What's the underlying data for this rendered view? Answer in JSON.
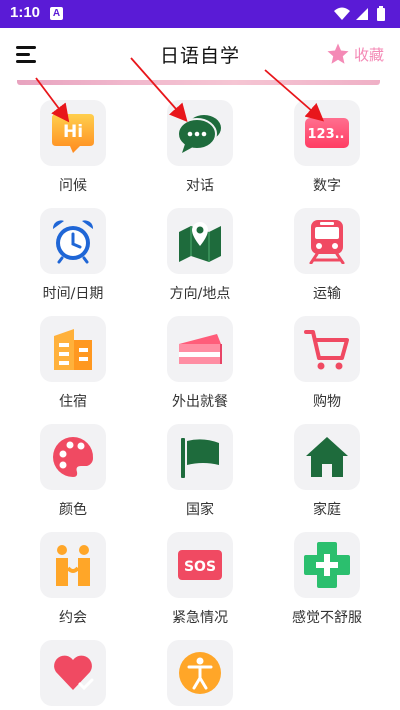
{
  "status_bar": {
    "time": "1:10",
    "notification_letter": "A",
    "icons": [
      "wifi-icon",
      "cellular-signal-icon",
      "battery-icon"
    ]
  },
  "app_bar": {
    "title": "日语自学",
    "favorites_label": "收藏",
    "icons": [
      "menu-icon",
      "star-icon"
    ]
  },
  "colors": {
    "status_bar": "#5a1bd6",
    "accent_pink": "#f48ab6",
    "tile_background": "#f2f2f4",
    "annotation_arrow": "#e8161b"
  },
  "categories": [
    {
      "label": "问候",
      "icon": "greeting-hi-icon"
    },
    {
      "label": "对话",
      "icon": "chat-bubble-icon"
    },
    {
      "label": "数字",
      "icon": "numbers-123-icon"
    },
    {
      "label": "时间/日期",
      "icon": "alarm-clock-icon"
    },
    {
      "label": "方向/地点",
      "icon": "map-pin-icon"
    },
    {
      "label": "运输",
      "icon": "train-icon"
    },
    {
      "label": "住宿",
      "icon": "building-icon"
    },
    {
      "label": "外出就餐",
      "icon": "cake-icon"
    },
    {
      "label": "购物",
      "icon": "shopping-cart-icon"
    },
    {
      "label": "颜色",
      "icon": "palette-icon"
    },
    {
      "label": "国家",
      "icon": "flag-icon"
    },
    {
      "label": "家庭",
      "icon": "house-icon"
    },
    {
      "label": "约会",
      "icon": "couple-icon"
    },
    {
      "label": "紧急情况",
      "icon": "sos-icon"
    },
    {
      "label": "感觉不舒服",
      "icon": "medical-cross-icon"
    },
    {
      "label": "",
      "icon": "heart-hand-icon"
    },
    {
      "label": "",
      "icon": "accessibility-person-icon"
    }
  ]
}
